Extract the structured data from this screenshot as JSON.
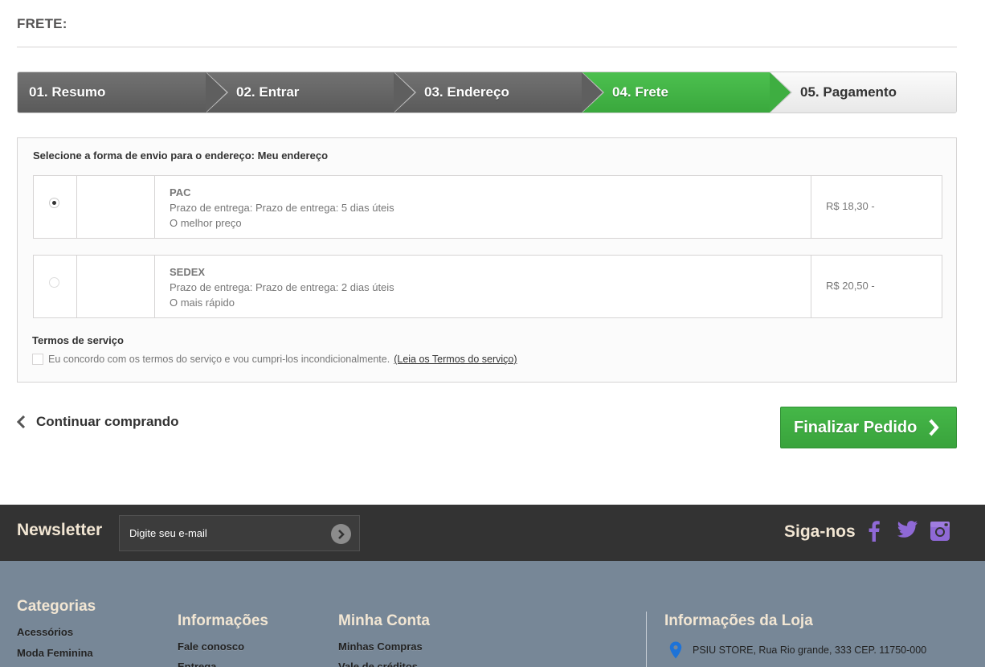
{
  "page": {
    "heading": "FRETE:"
  },
  "steps": [
    {
      "label": "01. Resumo",
      "state": "done"
    },
    {
      "label": "02. Entrar",
      "state": "done"
    },
    {
      "label": "03. Endereço",
      "state": "done"
    },
    {
      "label": "04. Frete",
      "state": "active"
    },
    {
      "label": "05. Pagamento",
      "state": "todo"
    }
  ],
  "shipping": {
    "title": "Selecione a forma de envio para o endereço: Meu endereço",
    "carriers": [
      {
        "name": "PAC",
        "delay": "Prazo de entrega: Prazo de entrega: 5 dias úteis",
        "note": "O melhor preço",
        "price": "R$ 18,30 -",
        "selected": true
      },
      {
        "name": "SEDEX",
        "delay": "Prazo de entrega: Prazo de entrega: 2 dias úteis",
        "note": "O mais rápido",
        "price": "R$ 20,50 -",
        "selected": false
      }
    ],
    "terms_title": "Termos de serviço",
    "terms_text": "Eu concordo com os termos do serviço e vou cumpri-los incondicionalmente.",
    "terms_link": "(Leia os Termos do serviço)"
  },
  "actions": {
    "continue_label": "Continuar comprando",
    "finish_label": "Finalizar Pedido"
  },
  "newsletter": {
    "title": "Newsletter",
    "placeholder": "Digite seu e-mail",
    "follow_title": "Siga-nos",
    "social_icons": [
      "facebook-icon",
      "twitter-icon",
      "instagram-icon"
    ]
  },
  "footer": {
    "categories": {
      "title": "Categorias",
      "links": [
        "Acessórios",
        "Moda Feminina"
      ]
    },
    "info": {
      "title": "Informações",
      "links": [
        "Fale conosco",
        "Entrega"
      ]
    },
    "account": {
      "title": "Minha Conta",
      "links": [
        "Minhas Compras",
        "Vale de créditos"
      ]
    },
    "store": {
      "title": "Informações da Loja",
      "address": "PSIU STORE, Rua Rio grande, 333 CEP. 11750-000"
    }
  },
  "colors": {
    "accent_green": "#3fae42",
    "step_dark": "#5f5f5f",
    "footer_dark": "#333333",
    "footer_blue": "#778797",
    "social_purple": "#8f69d6",
    "pin_blue": "#1e73d8"
  }
}
